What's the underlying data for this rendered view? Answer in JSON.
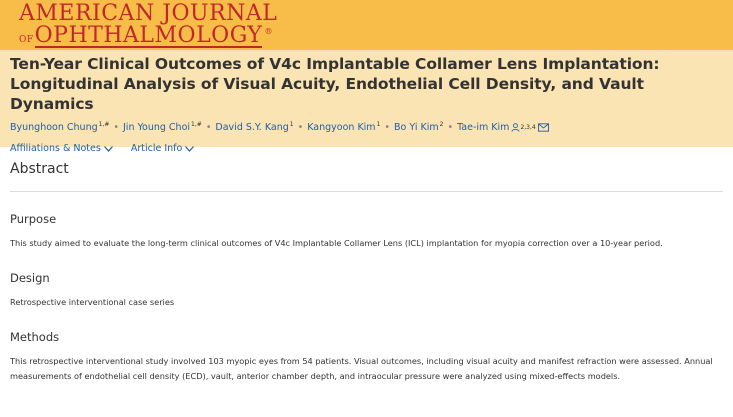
{
  "journal": {
    "name_line1": "AMERICAN JOURNAL",
    "name_of": "OF",
    "name_line2": "OPHTHALMOLOGY",
    "trademark": "®"
  },
  "article": {
    "title": "Ten-Year Clinical Outcomes of V4c Implantable Collamer Lens Implantation: Longitudinal Analysis of Visual Acuity, Endothelial Cell Density, and Vault Dynamics",
    "authors": [
      {
        "name": "Byunghoon Chung",
        "sup": "1,#"
      },
      {
        "name": "Jin Young Choi",
        "sup": "1,#"
      },
      {
        "name": "David S.Y. Kang",
        "sup": "1"
      },
      {
        "name": "Kangyoon Kim",
        "sup": "1"
      },
      {
        "name": "Bo Yi Kim",
        "sup": "2"
      },
      {
        "name": "Tae-im Kim",
        "sup": "2,3,4"
      }
    ],
    "links": {
      "affiliations": "Affiliations & Notes",
      "article_info": "Article Info"
    }
  },
  "abstract": {
    "heading": "Abstract",
    "sections": [
      {
        "title": "Purpose",
        "text": "This study aimed to evaluate the long-term clinical outcomes of V4c Implantable Collamer Lens (ICL) implantation for myopia correction over a 10-year period."
      },
      {
        "title": "Design",
        "text": "Retrospective interventional case series"
      },
      {
        "title": "Methods",
        "text": "This retrospective interventional study involved 103 myopic eyes from 54 patients. Visual outcomes, including visual acuity and manifest refraction were assessed. Annual measurements of endothelial cell density (ECD), vault, anterior chamber depth, and intraocular pressure were analyzed using mixed-effects models."
      }
    ]
  },
  "colors": {
    "header_bg": "#f8bd48",
    "title_bg": "#fbe4b4",
    "logo_red": "#c0272d",
    "link_blue": "#1f5ea8"
  }
}
